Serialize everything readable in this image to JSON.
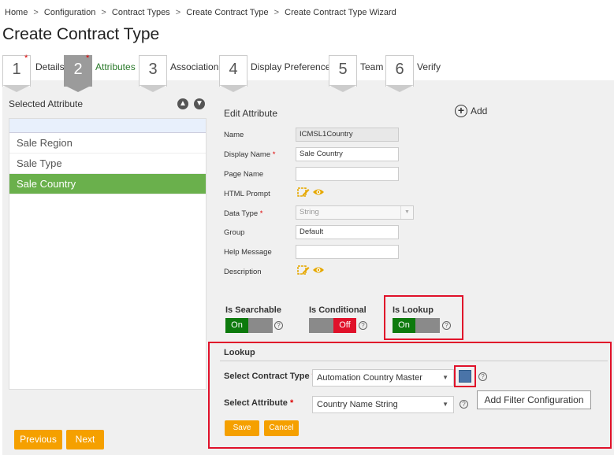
{
  "breadcrumb": [
    "Home",
    "Configuration",
    "Contract Types",
    "Create Contract Type",
    "Create Contract Type Wizard"
  ],
  "breadcrumb_sep": ">",
  "page_title": "Create Contract Type",
  "steps": [
    {
      "num": "1",
      "label": "Details",
      "required": "*"
    },
    {
      "num": "2",
      "label": "Attributes",
      "required": "*"
    },
    {
      "num": "3",
      "label": "Association"
    },
    {
      "num": "4",
      "label": "Display Preference"
    },
    {
      "num": "5",
      "label": "Team"
    },
    {
      "num": "6",
      "label": "Verify"
    }
  ],
  "left_panel": {
    "title": "Selected Attribute",
    "up_icon": "arrow-up-circle-icon",
    "down_icon": "arrow-down-circle-icon",
    "items": [
      "Sale Region",
      "Sale Type",
      "Sale Country"
    ]
  },
  "buttons": {
    "previous": "Previous",
    "next": "Next"
  },
  "edit": {
    "title": "Edit  Attribute",
    "add": "Add",
    "required_mark": "*",
    "fields": {
      "name": {
        "label": "Name",
        "value": "ICMSL1Country"
      },
      "display_name": {
        "label": "Display Name",
        "value": "Sale Country"
      },
      "page_name": {
        "label": "Page Name",
        "value": ""
      },
      "html_prompt": {
        "label": "HTML Prompt"
      },
      "data_type": {
        "label": "Data Type",
        "value": "String"
      },
      "group": {
        "label": "Group",
        "value": "Default"
      },
      "help_message": {
        "label": "Help Message",
        "value": ""
      },
      "description": {
        "label": "Description"
      }
    }
  },
  "toggles": {
    "searchable": {
      "label": "Is Searchable",
      "state": "On"
    },
    "conditional": {
      "label": "Is Conditional",
      "state": "Off"
    },
    "lookup": {
      "label": "Is Lookup",
      "state": "On"
    }
  },
  "help_glyph": "?",
  "lookup": {
    "title": "Lookup",
    "contract_type_label": "Select Contract Type",
    "contract_type_value": "Automation Country Master",
    "attribute_label": "Select Attribute",
    "attribute_value": "Country Name String",
    "required_mark": "*",
    "tooltip": "Add Filter Configuration",
    "save": "Save",
    "cancel": "Cancel"
  },
  "colors": {
    "accent_orange": "#f5a000",
    "selected_green": "#6ab04c",
    "toggle_on": "#0d7a0d",
    "toggle_off": "#e0112a",
    "highlight_red": "#e0112a"
  }
}
